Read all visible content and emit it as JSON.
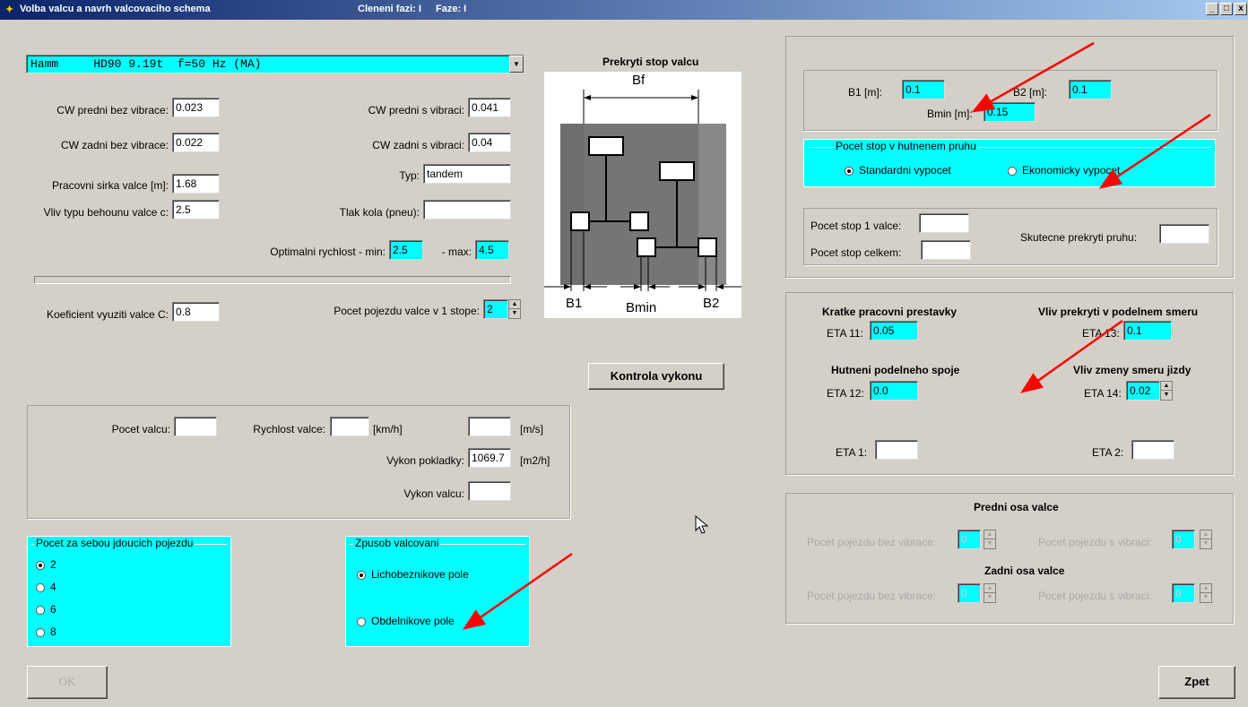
{
  "window": {
    "title": "Volba valcu a navrh valcovaciho schema",
    "cleneni": "Cleneni fazi: I",
    "faze": "Faze: I",
    "min": "_",
    "max": "□",
    "close": "x"
  },
  "roller_select": {
    "value": "Hamm     HD90 9.19t  f=50 Hz (MA)"
  },
  "left": {
    "cw_front_novib_label": "CW predni bez vibrace:",
    "cw_front_novib": "0.023",
    "cw_front_vib_label": "CW predni s vibraci:",
    "cw_front_vib": "0.041",
    "cw_rear_novib_label": "CW zadni bez vibrace:",
    "cw_rear_novib": "0.022",
    "cw_rear_vib_label": "CW zadni s vibraci:",
    "cw_rear_vib": "0.04",
    "work_width_label": "Pracovni sirka valce [m]:",
    "work_width": "1.68",
    "type_label": "Typ:",
    "type": "tandem",
    "drum_type_label": "Vliv typu behounu valce c:",
    "drum_type": "2.5",
    "tire_pressure_label": "Tlak kola (pneu):",
    "tire_pressure": "",
    "opt_speed_label": "Optimalni rychlost - min:",
    "opt_speed_min": "2.5",
    "max_label": "- max:",
    "opt_speed_max": "4.5",
    "coef_label": "Koeficient vyuziti valce C:",
    "coef": "0.8",
    "passes_label": "Pocet pojezdu valce v 1 stope:",
    "passes": "2"
  },
  "diagram": {
    "title": "Prekryti stop valcu",
    "bf": "Bf",
    "b1": "B1",
    "bmin": "Bmin",
    "b2": "B2"
  },
  "check_button": "Kontrola vykonu",
  "perf": {
    "count_label": "Pocet valcu:",
    "count": "",
    "speed_label": "Rychlost valce:",
    "speed_kmh": "",
    "kmh": "[km/h]",
    "speed_ms": "",
    "ms": "[m/s]",
    "paver_label": "Vykon pokladky:",
    "paver": "1069.7",
    "m2h": "[m2/h]",
    "roller_label": "Vykon valcu:",
    "roller": ""
  },
  "consecutive": {
    "legend": "Pocet za sebou jdoucich pojezdu",
    "options": [
      "2",
      "4",
      "6",
      "8"
    ]
  },
  "method": {
    "legend": "Zpusob valcovani",
    "opt1": "Lichobeznikove pole",
    "opt2": "Obdelnikove pole"
  },
  "right": {
    "b1_label": "B1   [m]:",
    "b1": "0.1",
    "b2_label": "B2   [m]:",
    "b2": "0.1",
    "bmin_label": "Bmin [m]:",
    "bmin": "0.15",
    "tracks_legend": "Pocet stop v hutnenem pruhu",
    "std": "Standardni vypocet",
    "eco": "Ekonomicky vypocet",
    "tracks1_label": "Pocet stop 1 valce:",
    "tracks1": "",
    "tracks_total_label": "Pocet stop celkem:",
    "tracks_total": "",
    "actual_overlap_label": "Skutecne prekryti pruhu:",
    "actual_overlap": ""
  },
  "eta": {
    "short_breaks": "Kratke pracovni prestavky",
    "eta11_label": "ETA 11:",
    "eta11": "0.05",
    "long_overlap": "Vliv prekryti v podelnem smeru",
    "eta13_label": "ETA 13:",
    "eta13": "0.1",
    "joint": "Hutneni podelneho spoje",
    "eta12_label": "ETA 12:",
    "eta12": "0.0",
    "dir_change": "Vliv zmeny smeru jizdy",
    "eta14_label": "ETA 14:",
    "eta14": "0.02",
    "eta1_label": "ETA 1:",
    "eta1": "",
    "eta2_label": "ETA 2:",
    "eta2": ""
  },
  "axles": {
    "front": "Predni osa valce",
    "rear": "Zadni osa valce",
    "novib_label": "Pocet pojezdu bez vibrace:",
    "vib_label": "Pocet pojezdu s vibraci:",
    "front_novib": "0",
    "front_vib": "0",
    "rear_novib": "0",
    "rear_vib": "0"
  },
  "buttons": {
    "ok": "OK",
    "back": "Zpet"
  }
}
